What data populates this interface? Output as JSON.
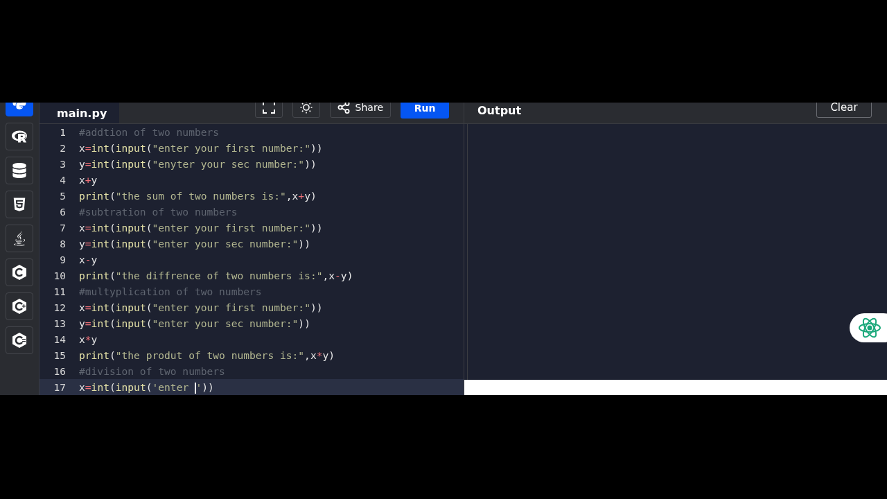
{
  "sidebar": {
    "items": [
      {
        "kind": "python",
        "selected": true
      },
      {
        "kind": "r",
        "selected": false
      },
      {
        "kind": "database",
        "selected": false
      },
      {
        "kind": "html",
        "selected": false
      },
      {
        "kind": "java",
        "selected": false
      },
      {
        "kind": "c",
        "selected": false
      },
      {
        "kind": "cpp",
        "selected": false
      },
      {
        "kind": "csharp",
        "selected": false
      }
    ]
  },
  "editor": {
    "tab": "main.py",
    "share": "Share",
    "run": "Run",
    "lines": [
      {
        "number": "1",
        "active": false,
        "tokens": [
          {
            "t": "#addtion of two numbers",
            "kind": "comment"
          }
        ]
      },
      {
        "number": "2",
        "active": false,
        "tokens": [
          {
            "t": "x",
            "kind": "plain"
          },
          {
            "t": "=",
            "kind": "op"
          },
          {
            "t": "int",
            "kind": "fn"
          },
          {
            "t": "(",
            "kind": "plain"
          },
          {
            "t": "input",
            "kind": "fn"
          },
          {
            "t": "(",
            "kind": "plain"
          },
          {
            "t": "\"enter your first number:\"",
            "kind": "str"
          },
          {
            "t": "))",
            "kind": "plain"
          }
        ]
      },
      {
        "number": "3",
        "active": false,
        "tokens": [
          {
            "t": "y",
            "kind": "plain"
          },
          {
            "t": "=",
            "kind": "op"
          },
          {
            "t": "int",
            "kind": "fn"
          },
          {
            "t": "(",
            "kind": "plain"
          },
          {
            "t": "input",
            "kind": "fn"
          },
          {
            "t": "(",
            "kind": "plain"
          },
          {
            "t": "\"enyter your sec number:\"",
            "kind": "str"
          },
          {
            "t": "))",
            "kind": "plain"
          }
        ]
      },
      {
        "number": "4",
        "active": false,
        "tokens": [
          {
            "t": "x",
            "kind": "plain"
          },
          {
            "t": "+",
            "kind": "op"
          },
          {
            "t": "y",
            "kind": "plain"
          }
        ]
      },
      {
        "number": "5",
        "active": false,
        "tokens": [
          {
            "t": "print",
            "kind": "fn"
          },
          {
            "t": "(",
            "kind": "plain"
          },
          {
            "t": "\"the sum of two numbers is:\"",
            "kind": "str"
          },
          {
            "t": ",x",
            "kind": "plain"
          },
          {
            "t": "+",
            "kind": "op"
          },
          {
            "t": "y)",
            "kind": "plain"
          }
        ]
      },
      {
        "number": "6",
        "active": false,
        "tokens": [
          {
            "t": "#subtration of two numbers",
            "kind": "comment"
          }
        ]
      },
      {
        "number": "7",
        "active": false,
        "tokens": [
          {
            "t": "x",
            "kind": "plain"
          },
          {
            "t": "=",
            "kind": "op"
          },
          {
            "t": "int",
            "kind": "fn"
          },
          {
            "t": "(",
            "kind": "plain"
          },
          {
            "t": "input",
            "kind": "fn"
          },
          {
            "t": "(",
            "kind": "plain"
          },
          {
            "t": "\"enter your first number:\"",
            "kind": "str"
          },
          {
            "t": "))",
            "kind": "plain"
          }
        ]
      },
      {
        "number": "8",
        "active": false,
        "tokens": [
          {
            "t": "y",
            "kind": "plain"
          },
          {
            "t": "=",
            "kind": "op"
          },
          {
            "t": "int",
            "kind": "fn"
          },
          {
            "t": "(",
            "kind": "plain"
          },
          {
            "t": "input",
            "kind": "fn"
          },
          {
            "t": "(",
            "kind": "plain"
          },
          {
            "t": "\"enter your sec number:\"",
            "kind": "str"
          },
          {
            "t": "))",
            "kind": "plain"
          }
        ]
      },
      {
        "number": "9",
        "active": false,
        "tokens": [
          {
            "t": "x",
            "kind": "plain"
          },
          {
            "t": "-",
            "kind": "op"
          },
          {
            "t": "y",
            "kind": "plain"
          }
        ]
      },
      {
        "number": "10",
        "active": false,
        "tokens": [
          {
            "t": "print",
            "kind": "fn"
          },
          {
            "t": "(",
            "kind": "plain"
          },
          {
            "t": "\"the diffrence of two numbers is:\"",
            "kind": "str"
          },
          {
            "t": ",x",
            "kind": "plain"
          },
          {
            "t": "-",
            "kind": "op"
          },
          {
            "t": "y)",
            "kind": "plain"
          }
        ]
      },
      {
        "number": "11",
        "active": false,
        "tokens": [
          {
            "t": "#multyplication of two numbers",
            "kind": "comment"
          }
        ]
      },
      {
        "number": "12",
        "active": false,
        "tokens": [
          {
            "t": "x",
            "kind": "plain"
          },
          {
            "t": "=",
            "kind": "op"
          },
          {
            "t": "int",
            "kind": "fn"
          },
          {
            "t": "(",
            "kind": "plain"
          },
          {
            "t": "input",
            "kind": "fn"
          },
          {
            "t": "(",
            "kind": "plain"
          },
          {
            "t": "\"enter your first number:\"",
            "kind": "str"
          },
          {
            "t": "))",
            "kind": "plain"
          }
        ]
      },
      {
        "number": "13",
        "active": false,
        "tokens": [
          {
            "t": "y",
            "kind": "plain"
          },
          {
            "t": "=",
            "kind": "op"
          },
          {
            "t": "int",
            "kind": "fn"
          },
          {
            "t": "(",
            "kind": "plain"
          },
          {
            "t": "input",
            "kind": "fn"
          },
          {
            "t": "(",
            "kind": "plain"
          },
          {
            "t": "\"enter your sec number:\"",
            "kind": "str"
          },
          {
            "t": "))",
            "kind": "plain"
          }
        ]
      },
      {
        "number": "14",
        "active": false,
        "tokens": [
          {
            "t": "x",
            "kind": "plain"
          },
          {
            "t": "*",
            "kind": "op"
          },
          {
            "t": "y",
            "kind": "plain"
          }
        ]
      },
      {
        "number": "15",
        "active": false,
        "tokens": [
          {
            "t": "print",
            "kind": "fn"
          },
          {
            "t": "(",
            "kind": "plain"
          },
          {
            "t": "\"the produt of two numbers is:\"",
            "kind": "str"
          },
          {
            "t": ",x",
            "kind": "plain"
          },
          {
            "t": "*",
            "kind": "op"
          },
          {
            "t": "y)",
            "kind": "plain"
          }
        ]
      },
      {
        "number": "16",
        "active": false,
        "tokens": [
          {
            "t": "#division of two numbers",
            "kind": "comment"
          }
        ]
      },
      {
        "number": "17",
        "active": true,
        "tokens": [
          {
            "t": "x",
            "kind": "plain"
          },
          {
            "t": "=",
            "kind": "op"
          },
          {
            "t": "int",
            "kind": "fn"
          },
          {
            "t": "(",
            "kind": "plain"
          },
          {
            "t": "input",
            "kind": "fn"
          },
          {
            "t": "(",
            "kind": "plain"
          },
          {
            "t": "'enter ",
            "kind": "str"
          },
          {
            "kind": "caret"
          },
          {
            "t": "'",
            "kind": "str"
          },
          {
            "t": "))",
            "kind": "plain"
          }
        ]
      }
    ]
  },
  "output": {
    "title": "Output",
    "clear": "Clear"
  }
}
